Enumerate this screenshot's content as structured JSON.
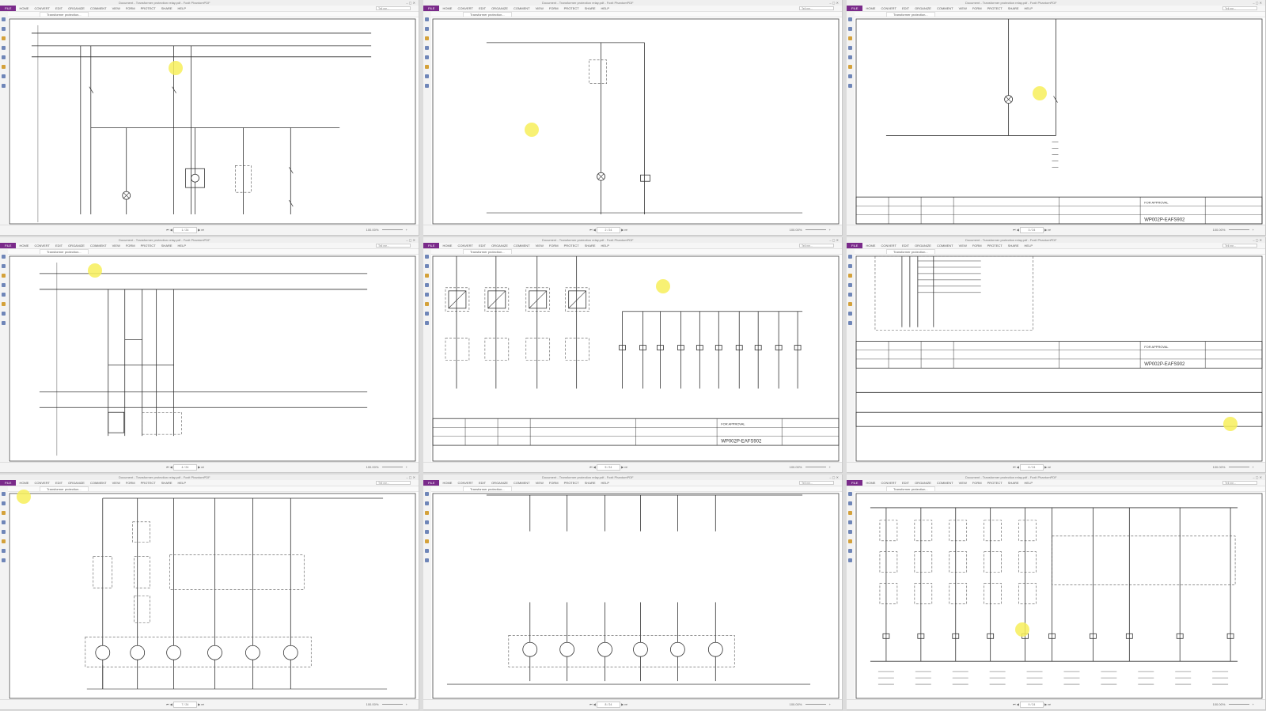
{
  "app": {
    "window_title": "Document - Transformer protection relay.pdf - Foxit PhantomPDF",
    "ribbon_tabs": [
      "FILE",
      "HOME",
      "CONVERT",
      "EDIT",
      "ORGANIZE",
      "COMMENT",
      "VIEW",
      "FORM",
      "PROTECT",
      "SHARE",
      "HELP"
    ],
    "search_placeholder": "Tell me...",
    "document_tab": "Transformer protection...",
    "window_controls": "– ▢ ✕",
    "page_display": "1 / 24",
    "zoom_level": "100.00%"
  },
  "colors": {
    "file_tab": "#7a2a8a",
    "highlight": "#f7ef5a",
    "line": "#333333",
    "dash": "#555555"
  },
  "tiles": [
    {
      "id": "t1",
      "page": "1 / 24"
    },
    {
      "id": "t2",
      "page": "2 / 24"
    },
    {
      "id": "t3",
      "page": "3 / 24"
    },
    {
      "id": "t4",
      "page": "4 / 24"
    },
    {
      "id": "t5",
      "page": "5 / 24"
    },
    {
      "id": "t6",
      "page": "6 / 24"
    },
    {
      "id": "t7",
      "page": "7 / 24"
    },
    {
      "id": "t8",
      "page": "8 / 24"
    },
    {
      "id": "t9",
      "page": "9 / 24"
    }
  ],
  "title_block": {
    "status": "FOR APPROVAL",
    "drawing_number": "WP002P-EAFS902"
  }
}
